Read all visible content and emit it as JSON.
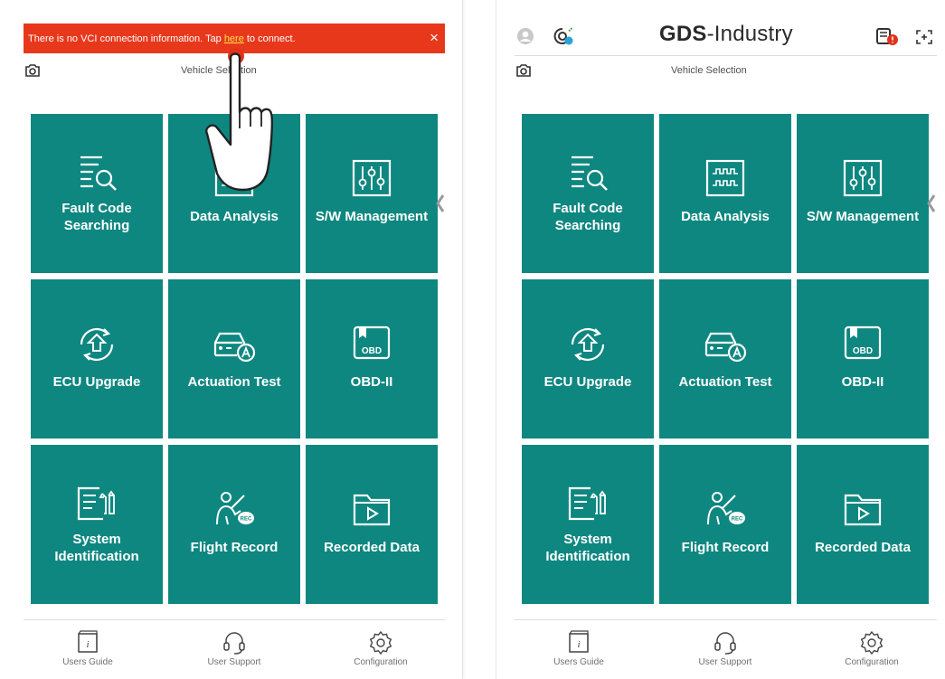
{
  "screens": [
    {
      "banner": {
        "text_before": "There is no VCI connection information. Tap",
        "link_text": "here",
        "text_after": "to connect.",
        "close": "×"
      },
      "vehicle_selection": "Vehicle Selection",
      "tiles": [
        {
          "label": "Fault Code Searching",
          "icon": "fault-code-search-icon"
        },
        {
          "label": "Data Analysis",
          "icon": "waveform-icon"
        },
        {
          "label": "S/W Management",
          "icon": "sliders-icon"
        },
        {
          "label": "ECU Upgrade",
          "icon": "ecu-upgrade-icon"
        },
        {
          "label": "Actuation Test",
          "icon": "car-actuation-icon"
        },
        {
          "label": "OBD-II",
          "icon": "obd-icon"
        },
        {
          "label": "System Identification",
          "icon": "system-id-icon"
        },
        {
          "label": "Flight Record",
          "icon": "flight-record-icon"
        },
        {
          "label": "Recorded Data",
          "icon": "recorded-folder-icon"
        }
      ],
      "nav": [
        {
          "label": "Users Guide",
          "icon": "book-info-icon"
        },
        {
          "label": "User Support",
          "icon": "headset-icon"
        },
        {
          "label": "Configuration",
          "icon": "gear-icon"
        }
      ]
    },
    {
      "header": {
        "brand_prefix": "GDS",
        "brand_suffix": "-Industry"
      },
      "vehicle_selection": "Vehicle Selection",
      "tiles": [
        {
          "label": "Fault Code Searching",
          "icon": "fault-code-search-icon"
        },
        {
          "label": "Data Analysis",
          "icon": "waveform-icon"
        },
        {
          "label": "S/W Management",
          "icon": "sliders-icon"
        },
        {
          "label": "ECU Upgrade",
          "icon": "ecu-upgrade-icon"
        },
        {
          "label": "Actuation Test",
          "icon": "car-actuation-icon"
        },
        {
          "label": "OBD-II",
          "icon": "obd-icon"
        },
        {
          "label": "System Identification",
          "icon": "system-id-icon"
        },
        {
          "label": "Flight Record",
          "icon": "flight-record-icon"
        },
        {
          "label": "Recorded Data",
          "icon": "recorded-folder-icon"
        }
      ],
      "nav": [
        {
          "label": "Users Guide",
          "icon": "book-info-icon"
        },
        {
          "label": "User Support",
          "icon": "headset-icon"
        },
        {
          "label": "Configuration",
          "icon": "gear-icon"
        }
      ]
    }
  ],
  "icon_text": {
    "obd_badge": "OBD",
    "rec_badge": "REC",
    "guide_glyph": "i"
  },
  "colors": {
    "tile": "#0e8780",
    "banner": "#e8381c",
    "link": "#ffe34a",
    "alert": "#e0321b"
  }
}
